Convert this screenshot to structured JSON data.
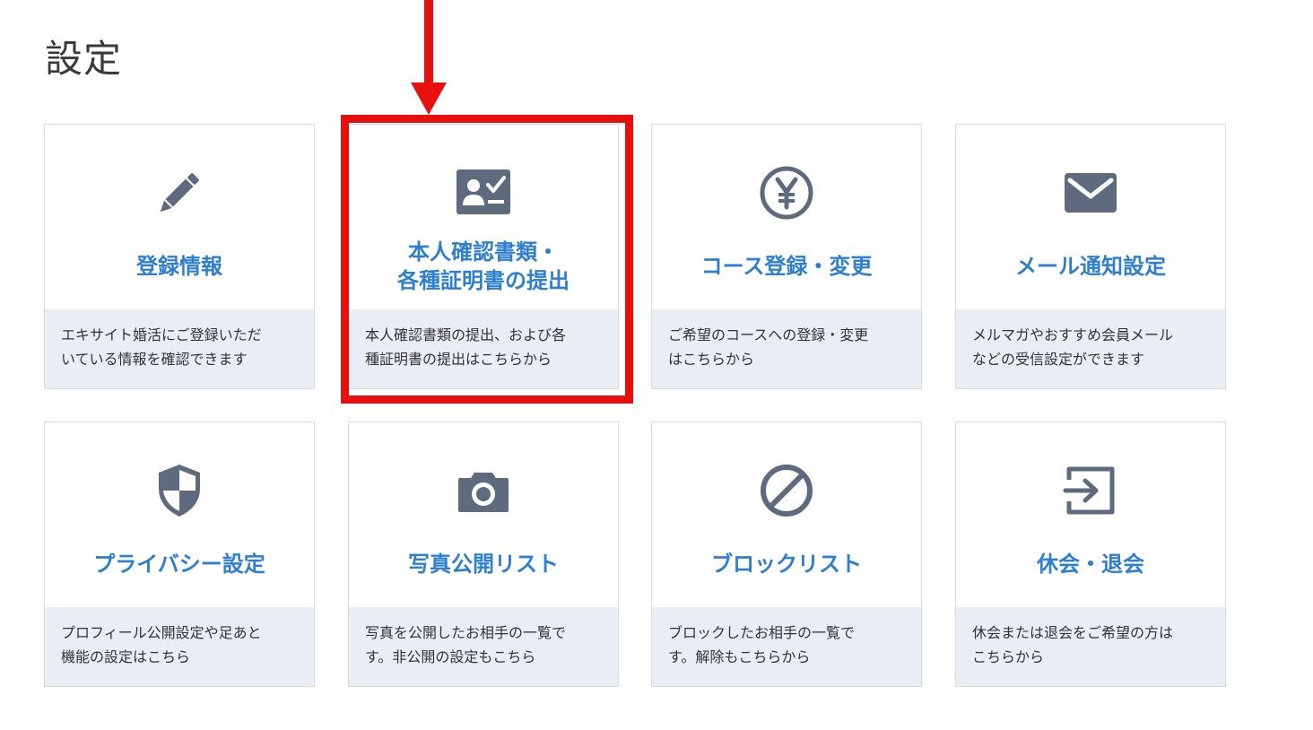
{
  "page": {
    "title": "設定"
  },
  "colors": {
    "title_text": "#3a3a3a",
    "card_title": "#2f7fd0",
    "icon": "#5e6b7e",
    "desc_bg": "#e9eef5",
    "highlight": "#e80f0f"
  },
  "cards": [
    {
      "icon": "pencil-icon",
      "title": "登録情報",
      "desc": "エキサイト婚活にご登録いただ\nいている情報を確認できます"
    },
    {
      "icon": "id-card-check-icon",
      "title": "本人確認書類・\n各種証明書の提出",
      "desc": "本人確認書類の提出、および各\n種証明書の提出はこちらから"
    },
    {
      "icon": "yen-icon",
      "title": "コース登録・変更",
      "desc": "ご希望のコースへの登録・変更\nはこちらから"
    },
    {
      "icon": "mail-icon",
      "title": "メール通知設定",
      "desc": "メルマガやおすすめ会員メール\nなどの受信設定ができます"
    },
    {
      "icon": "shield-icon",
      "title": "プライバシー設定",
      "desc": "プロフィール公開設定や足あと\n機能の設定はこちら"
    },
    {
      "icon": "camera-icon",
      "title": "写真公開リスト",
      "desc": "写真を公開したお相手の一覧で\nす。非公開の設定もこちら"
    },
    {
      "icon": "block-icon",
      "title": "ブロックリスト",
      "desc": "ブロックしたお相手の一覧で\nす。解除もこちらから"
    },
    {
      "icon": "exit-icon",
      "title": "休会・退会",
      "desc": "休会または退会をご希望の方は\nこちらから"
    }
  ]
}
